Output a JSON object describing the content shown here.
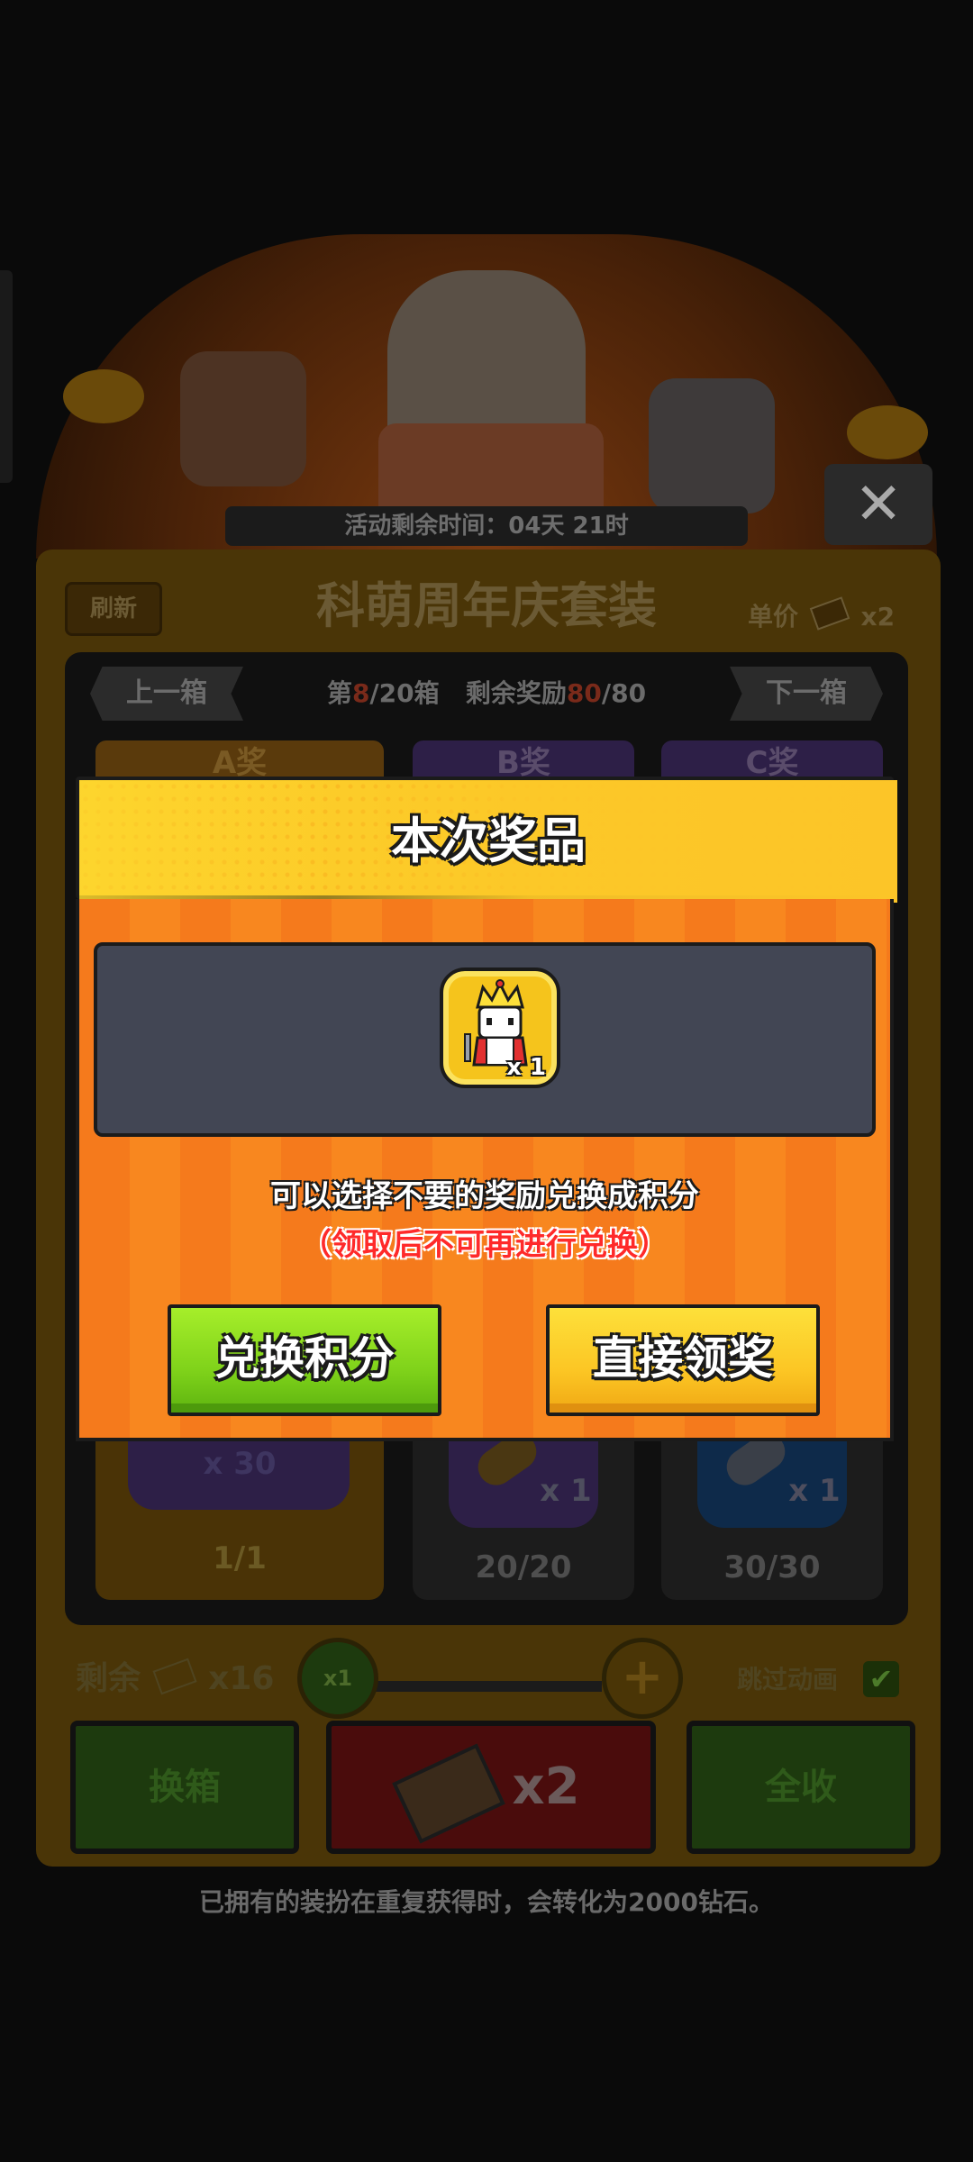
{
  "background": {
    "event_timer": "活动剩余时间：04天 21时",
    "close_label": "✕",
    "refresh_label": "刷新",
    "panel_title": "科萌周年庆套装",
    "unit_price_label": "单价",
    "unit_price_value": "x2",
    "prev_box_label": "上一箱",
    "next_box_label": "下一箱",
    "box_info": {
      "prefix": "第",
      "current": "8",
      "total_boxes": "/20箱",
      "remain_label": "剩余奖励",
      "remain_current": "80",
      "remain_total": "/80"
    },
    "tiers": [
      {
        "label": "A奖"
      },
      {
        "label": "B奖"
      },
      {
        "label": "C奖"
      }
    ],
    "cards": [
      {
        "qty": "x 30",
        "count": "1/1"
      },
      {
        "qty": "x 1",
        "count": "20/20"
      },
      {
        "qty": "x 1",
        "count": "30/30"
      }
    ],
    "remaining_label": "剩余",
    "remaining_value": "x16",
    "qty_selector": "x1",
    "plus_label": "+",
    "skip_anim_label": "跳过动画",
    "skip_anim_checked": true,
    "swap_box_label": "换箱",
    "draw_label": "x2",
    "collect_all_label": "全收",
    "footer_note": "已拥有的装扮在重复获得时，会转化为2000钻石。"
  },
  "modal": {
    "title": "本次奖品",
    "reward": {
      "icon": "king-character-icon",
      "qty": "x 1"
    },
    "hint": "可以选择不要的奖励兑换成积分",
    "warning": "（领取后不可再进行兑换）",
    "exchange_label": "兑换积分",
    "claim_label": "直接领奖"
  },
  "colors": {
    "modal_header": "#fcc62a",
    "modal_body": "#f57a1c",
    "reward_box": "#424654",
    "exchange_btn": "#7fd21a",
    "claim_btn": "#fcc624",
    "warning_text": "#ff2a2a"
  }
}
